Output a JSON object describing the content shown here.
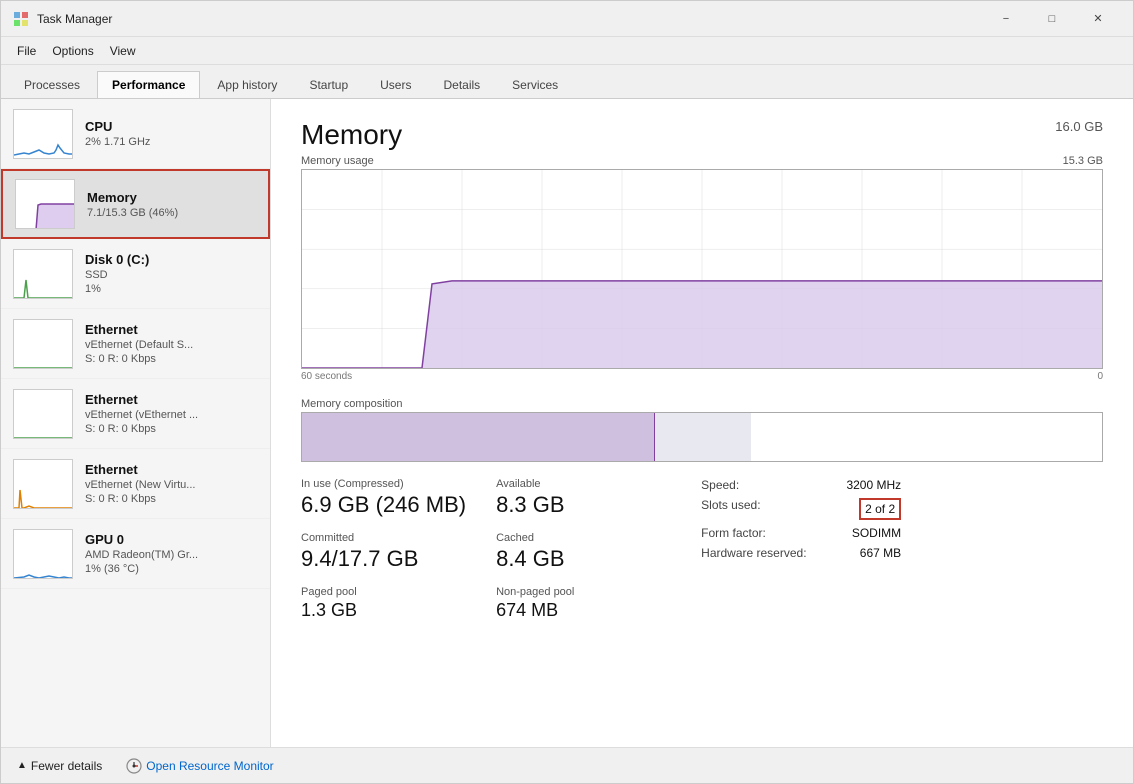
{
  "window": {
    "title": "Task Manager",
    "controls": [
      "minimize",
      "maximize",
      "close"
    ]
  },
  "menu": {
    "items": [
      "File",
      "Options",
      "View"
    ]
  },
  "tabs": {
    "items": [
      "Processes",
      "Performance",
      "App history",
      "Startup",
      "Users",
      "Details",
      "Services"
    ],
    "active": "Performance"
  },
  "sidebar": {
    "items": [
      {
        "id": "cpu",
        "title": "CPU",
        "sub1": "2% 1.71 GHz",
        "sub2": ""
      },
      {
        "id": "memory",
        "title": "Memory",
        "sub1": "7.1/15.3 GB (46%)",
        "sub2": ""
      },
      {
        "id": "disk",
        "title": "Disk 0 (C:)",
        "sub1": "SSD",
        "sub2": "1%"
      },
      {
        "id": "ethernet1",
        "title": "Ethernet",
        "sub1": "vEthernet (Default S...",
        "sub2": "S: 0 R: 0 Kbps"
      },
      {
        "id": "ethernet2",
        "title": "Ethernet",
        "sub1": "vEthernet (vEthernet ...",
        "sub2": "S: 0 R: 0 Kbps"
      },
      {
        "id": "ethernet3",
        "title": "Ethernet",
        "sub1": "vEthernet (New Virtu...",
        "sub2": "S: 0 R: 0 Kbps"
      },
      {
        "id": "gpu",
        "title": "GPU 0",
        "sub1": "AMD Radeon(TM) Gr...",
        "sub2": "1% (36 °C)"
      }
    ]
  },
  "detail": {
    "title": "Memory",
    "total": "16.0 GB",
    "chart_label": "Memory usage",
    "chart_max": "15.3 GB",
    "chart_time_start": "60 seconds",
    "chart_time_end": "0",
    "composition_label": "Memory composition",
    "stats": {
      "in_use_label": "In use (Compressed)",
      "in_use_value": "6.9 GB (246 MB)",
      "available_label": "Available",
      "available_value": "8.3 GB",
      "committed_label": "Committed",
      "committed_value": "9.4/17.7 GB",
      "cached_label": "Cached",
      "cached_value": "8.4 GB",
      "paged_pool_label": "Paged pool",
      "paged_pool_value": "1.3 GB",
      "non_paged_pool_label": "Non-paged pool",
      "non_paged_pool_value": "674 MB"
    },
    "right_stats": {
      "speed_label": "Speed:",
      "speed_value": "3200 MHz",
      "slots_label": "Slots used:",
      "slots_value": "2 of 2",
      "form_factor_label": "Form factor:",
      "form_factor_value": "SODIMM",
      "hardware_reserved_label": "Hardware reserved:",
      "hardware_reserved_value": "667 MB"
    }
  },
  "bottom_bar": {
    "fewer_details_label": "Fewer details",
    "open_resource_monitor_label": "Open Resource Monitor"
  }
}
